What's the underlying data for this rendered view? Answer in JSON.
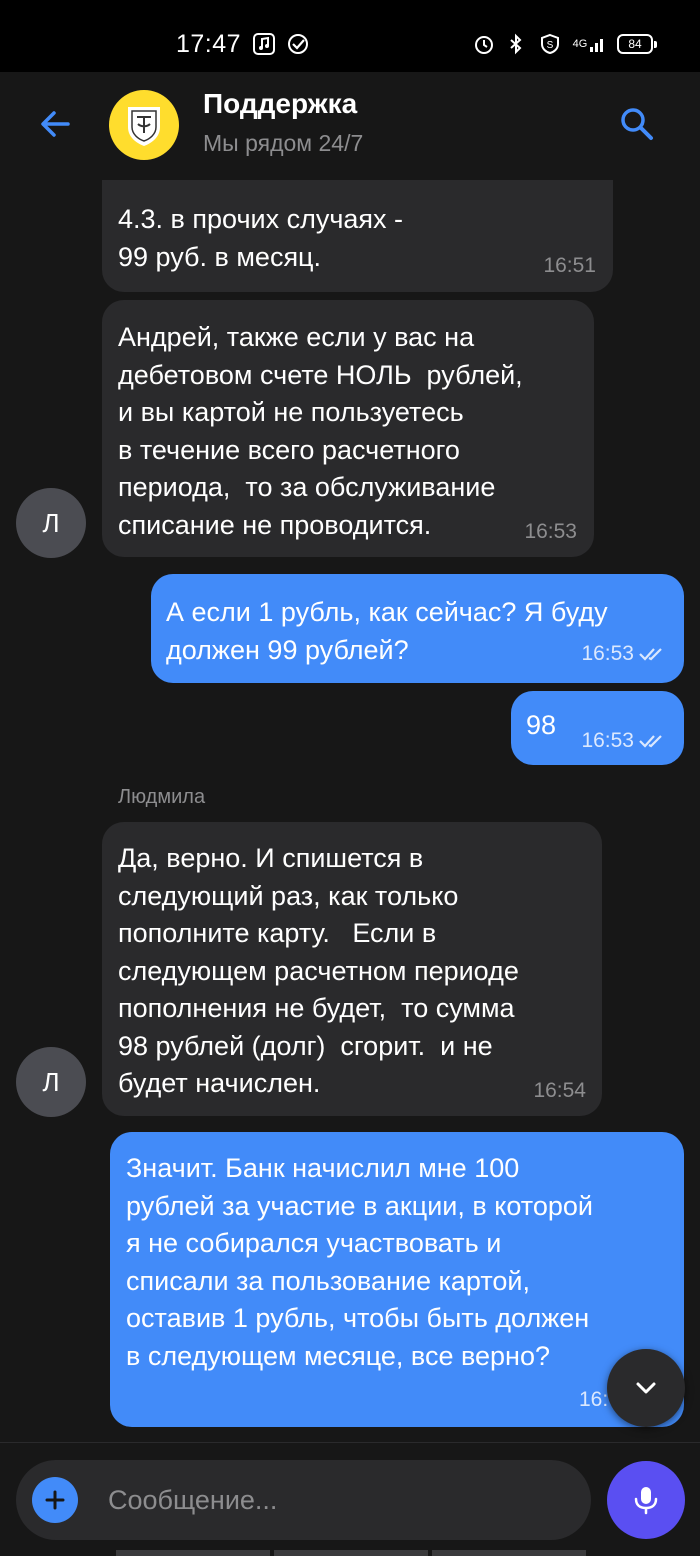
{
  "status_bar": {
    "time": "17:47",
    "network": "4G",
    "battery": "84",
    "icons": [
      "music-icon",
      "check-circle-icon",
      "alarm-icon",
      "bluetooth-icon",
      "shield-icon",
      "signal-icon"
    ]
  },
  "header": {
    "title": "Поддержка",
    "subtitle": "Мы рядом 24/7",
    "back_icon": "arrow-left-icon",
    "search_icon": "search-icon"
  },
  "messages": [
    {
      "direction": "incoming",
      "text": "4.3. в прочих случаях -\n99 руб. в месяц.",
      "time": "16:51"
    },
    {
      "direction": "incoming",
      "text": "Андрей, также если у вас на\nдебетовом счете НОЛЬ  рублей,\nи вы картой не пользуетесь\nв течение всего расчетного\nпериода,  то за обслуживание\nсписание не проводится.",
      "time": "16:53",
      "avatar": "Л"
    },
    {
      "direction": "outgoing",
      "text": "А если 1 рубль, как сейчас? Я буду\nдолжен 99 рублей?",
      "time": "16:53",
      "read": true
    },
    {
      "direction": "outgoing",
      "text": "98",
      "time": "16:53",
      "read": true
    },
    {
      "direction": "incoming",
      "sender": "Людмила",
      "text": "Да, верно. И спишется в\nследующий раз, как только\nпополните карту.   Если в\nследующем расчетном периоде\nпополнения не будет,  то сумма\n98 рублей (долг)  сгорит.  и не\nбудет начислен.",
      "time": "16:54",
      "avatar": "Л"
    },
    {
      "direction": "outgoing",
      "text": "Значит. Банк начислил мне 100\nрублей за участие в акции, в которой\nя не собирался участвовать и\nсписали за пользование картой,\nоставив 1 рубль, чтобы быть должен\nв следующем месяце, все верно?",
      "time": "16:",
      "read": false
    }
  ],
  "composer": {
    "placeholder": "Сообщение...",
    "value": "",
    "attach_icon": "plus-icon",
    "mic_icon": "microphone-icon"
  },
  "colors": {
    "background": "#171717",
    "incoming_bubble": "#2a2a2c",
    "outgoing_bubble": "#428bf9",
    "accent": "#428bf9",
    "brand_yellow": "#ffdd2d",
    "mic_button": "#5a4ff2",
    "secondary_text": "#8d8d8f"
  }
}
